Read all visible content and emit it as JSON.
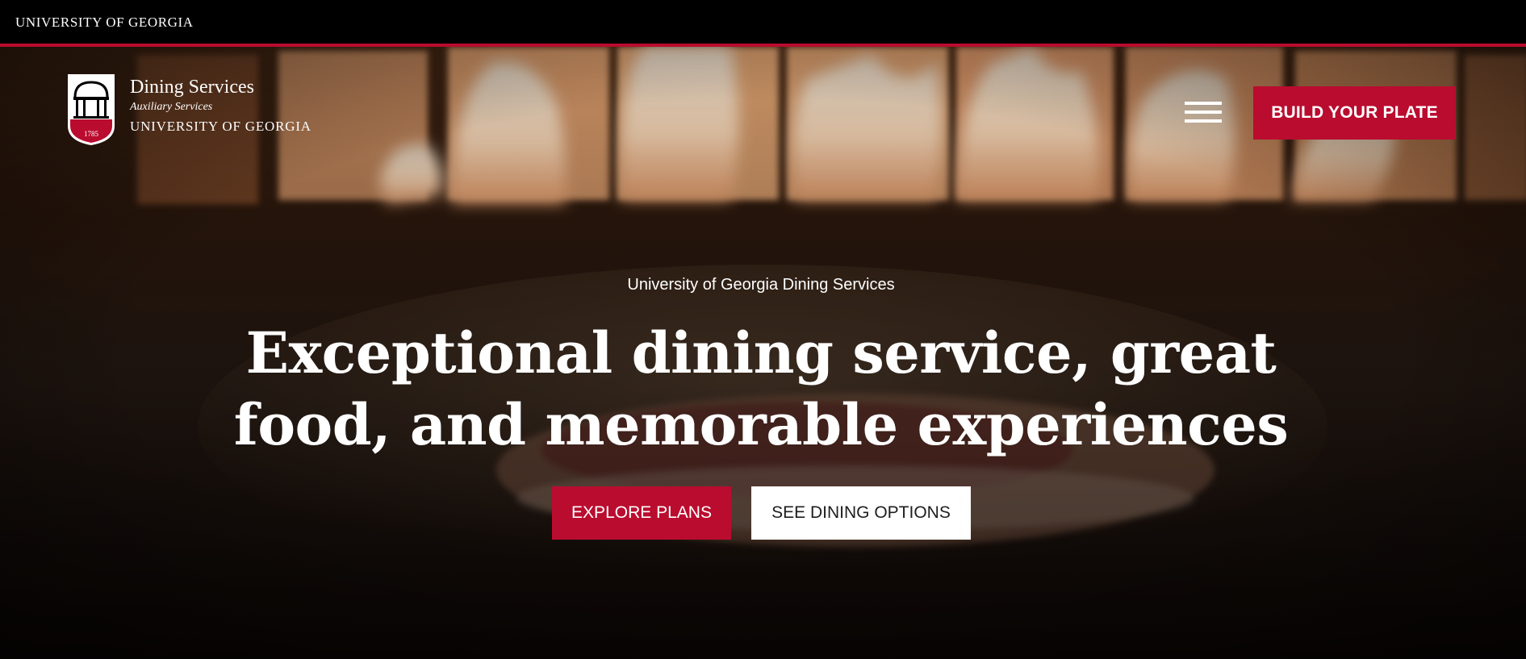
{
  "top_bar": {
    "university_link": "UNIVERSITY OF GEORGIA"
  },
  "header": {
    "logo": {
      "title": "Dining Services",
      "subtitle": "Auxiliary Services",
      "university": "UNIVERSITY OF GEORGIA",
      "seal_year": "1785"
    },
    "menu_icon": "hamburger-menu-icon",
    "cta_label": "BUILD YOUR PLATE"
  },
  "hero": {
    "eyebrow": "University of Georgia Dining Services",
    "headline": "Exceptional dining service, great food, and memorable experiences",
    "primary_button": "EXPLORE PLANS",
    "secondary_button": "SEE DINING OPTIONS"
  },
  "colors": {
    "brand_red": "#ba0c2f",
    "top_bar_bg": "#000000",
    "text_light": "#ffffff",
    "text_dark": "#1e1e1e"
  }
}
